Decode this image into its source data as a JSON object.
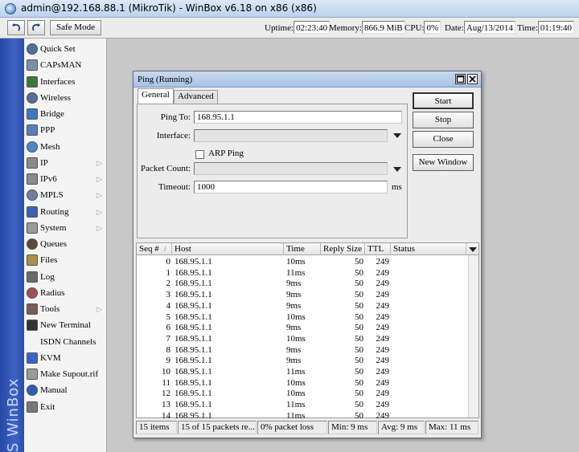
{
  "window": {
    "title": "admin@192.168.88.1 (MikroTik) - WinBox v6.18 on x86 (x86)"
  },
  "toolbar": {
    "undo_icon": "undo-icon",
    "redo_icon": "redo-icon",
    "safe_mode_label": "Safe Mode",
    "uptime_label": "Uptime:",
    "uptime_value": "02:23:40",
    "memory_label": "Memory:",
    "memory_value": "866.9 MiB",
    "cpu_label": "CPU:",
    "cpu_value": "0%",
    "date_label": "Date:",
    "date_value": "Aug/13/2014",
    "time_label": "Time:",
    "time_value": "01:19:40"
  },
  "side_band": {
    "text": "S WinBox"
  },
  "sidebar": {
    "items": [
      {
        "label": "Quick Set",
        "icon": "wand-icon",
        "submenu": false
      },
      {
        "label": "CAPsMAN",
        "icon": "capsman-icon",
        "submenu": false
      },
      {
        "label": "Interfaces",
        "icon": "interfaces-icon",
        "submenu": false
      },
      {
        "label": "Wireless",
        "icon": "antenna-icon",
        "submenu": false
      },
      {
        "label": "Bridge",
        "icon": "bridge-icon",
        "submenu": false
      },
      {
        "label": "PPP",
        "icon": "ppp-icon",
        "submenu": false
      },
      {
        "label": "Mesh",
        "icon": "mesh-icon",
        "submenu": false
      },
      {
        "label": "IP",
        "icon": "ip-icon",
        "submenu": true
      },
      {
        "label": "IPv6",
        "icon": "ipv6-icon",
        "submenu": true
      },
      {
        "label": "MPLS",
        "icon": "mpls-icon",
        "submenu": true
      },
      {
        "label": "Routing",
        "icon": "routing-icon",
        "submenu": true
      },
      {
        "label": "System",
        "icon": "gear-icon",
        "submenu": true
      },
      {
        "label": "Queues",
        "icon": "queues-icon",
        "submenu": false
      },
      {
        "label": "Files",
        "icon": "folder-icon",
        "submenu": false
      },
      {
        "label": "Log",
        "icon": "log-icon",
        "submenu": false
      },
      {
        "label": "Radius",
        "icon": "radius-icon",
        "submenu": false
      },
      {
        "label": "Tools",
        "icon": "tools-icon",
        "submenu": true
      },
      {
        "label": "New Terminal",
        "icon": "terminal-icon",
        "submenu": false
      },
      {
        "label": "ISDN Channels",
        "icon": "",
        "submenu": false
      },
      {
        "label": "KVM",
        "icon": "kvm-icon",
        "submenu": false
      },
      {
        "label": "Make Supout.rif",
        "icon": "document-icon",
        "submenu": false
      },
      {
        "label": "Manual",
        "icon": "help-icon",
        "submenu": false
      },
      {
        "label": "Exit",
        "icon": "exit-icon",
        "submenu": false
      }
    ],
    "arrow_glyph": "▷"
  },
  "ping": {
    "title": "Ping (Running)",
    "tabs": [
      "General",
      "Advanced"
    ],
    "fields": {
      "ping_to_label": "Ping To:",
      "ping_to_value": "168.95.1.1",
      "interface_label": "Interface:",
      "interface_value": "",
      "arp_ping_label": "ARP Ping",
      "packet_count_label": "Packet Count:",
      "packet_count_value": "",
      "timeout_label": "Timeout:",
      "timeout_value": "1000",
      "timeout_unit": "ms"
    },
    "buttons": {
      "start": "Start",
      "stop": "Stop",
      "close": "Close",
      "new_window": "New Window"
    },
    "table": {
      "columns": [
        "Seq #",
        "Host",
        "Time",
        "Reply Size",
        "TTL",
        "Status"
      ],
      "sort_indicator": "/",
      "rows": [
        {
          "seq": "0",
          "host": "168.95.1.1",
          "time": "10ms",
          "size": "50",
          "ttl": "249",
          "status": ""
        },
        {
          "seq": "1",
          "host": "168.95.1.1",
          "time": "11ms",
          "size": "50",
          "ttl": "249",
          "status": ""
        },
        {
          "seq": "2",
          "host": "168.95.1.1",
          "time": "9ms",
          "size": "50",
          "ttl": "249",
          "status": ""
        },
        {
          "seq": "3",
          "host": "168.95.1.1",
          "time": "9ms",
          "size": "50",
          "ttl": "249",
          "status": ""
        },
        {
          "seq": "4",
          "host": "168.95.1.1",
          "time": "9ms",
          "size": "50",
          "ttl": "249",
          "status": ""
        },
        {
          "seq": "5",
          "host": "168.95.1.1",
          "time": "10ms",
          "size": "50",
          "ttl": "249",
          "status": ""
        },
        {
          "seq": "6",
          "host": "168.95.1.1",
          "time": "9ms",
          "size": "50",
          "ttl": "249",
          "status": ""
        },
        {
          "seq": "7",
          "host": "168.95.1.1",
          "time": "10ms",
          "size": "50",
          "ttl": "249",
          "status": ""
        },
        {
          "seq": "8",
          "host": "168.95.1.1",
          "time": "9ms",
          "size": "50",
          "ttl": "249",
          "status": ""
        },
        {
          "seq": "9",
          "host": "168.95.1.1",
          "time": "9ms",
          "size": "50",
          "ttl": "249",
          "status": ""
        },
        {
          "seq": "10",
          "host": "168.95.1.1",
          "time": "11ms",
          "size": "50",
          "ttl": "249",
          "status": ""
        },
        {
          "seq": "11",
          "host": "168.95.1.1",
          "time": "10ms",
          "size": "50",
          "ttl": "249",
          "status": ""
        },
        {
          "seq": "12",
          "host": "168.95.1.1",
          "time": "10ms",
          "size": "50",
          "ttl": "249",
          "status": ""
        },
        {
          "seq": "13",
          "host": "168.95.1.1",
          "time": "11ms",
          "size": "50",
          "ttl": "249",
          "status": ""
        },
        {
          "seq": "14",
          "host": "168.95.1.1",
          "time": "11ms",
          "size": "50",
          "ttl": "249",
          "status": ""
        }
      ]
    },
    "status": {
      "items": "15 items",
      "packets": "15 of 15 packets re...",
      "loss": "0% packet loss",
      "min": "Min: 9 ms",
      "avg": "Avg: 9 ms",
      "max": "Max: 11 ms"
    }
  },
  "colors": {
    "side_band": "#2f55b5",
    "title_bar": "#c9daf1",
    "desktop": "#c8c8c8"
  }
}
